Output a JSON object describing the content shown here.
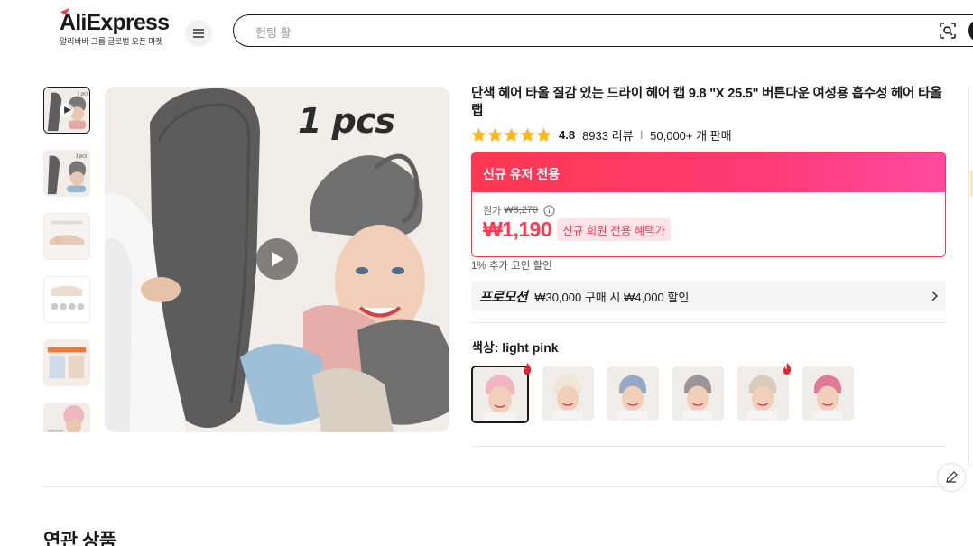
{
  "header": {
    "logo": "AliExpress",
    "logo_sub": "알리바바 그룹 글로벌 오픈 마켓",
    "search_placeholder": "헌팅 활"
  },
  "product": {
    "title": "단색 헤어 타올 질감 있는 드라이 헤어 캡 9.8 \"X 25.5\" 버튼다운 여성용 흡수성 헤어 타올 랩",
    "rating": "4.8",
    "reviews": "8933 리뷰",
    "sold": "50,000+ 개 판매",
    "image_label": "1 pcs"
  },
  "deal": {
    "header": "신규 유저 전용",
    "original_label": "원가",
    "original_price": "₩8,270",
    "price": "₩1,190",
    "badge": "신규 회원 전용 혜택가",
    "coin_text": "1% 추가 코인 할인"
  },
  "promo": {
    "tag": "프로모션",
    "text": "₩30,000 구매 시 ₩4,000 할인"
  },
  "variant": {
    "label": "색상: light pink",
    "colors": [
      "#f0b7c0",
      "#efe6d6",
      "#94a9c7",
      "#9c9597",
      "#d7ccbc",
      "#e07a98"
    ]
  },
  "related_title": "연관 상품",
  "colors": {
    "accent": "#fd384f",
    "text": "#191919"
  }
}
